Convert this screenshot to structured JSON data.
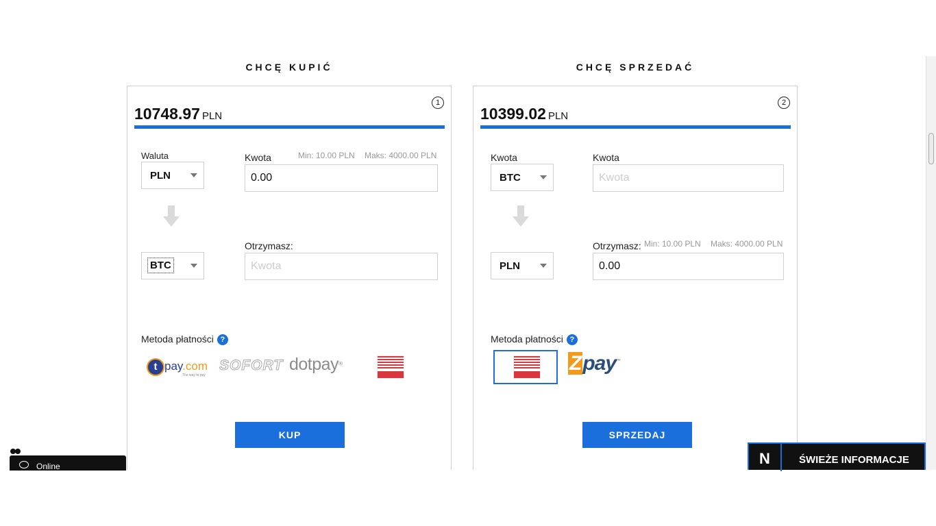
{
  "buy": {
    "heading": "CHCĘ KUPIĆ",
    "step": "1",
    "price": "10748.97",
    "price_currency": "PLN",
    "currency_label": "Waluta",
    "from_currency": "PLN",
    "amount_label": "Kwota",
    "min_hint": "Min: 10.00 PLN",
    "max_hint": "Maks: 4000.00 PLN",
    "amount_value": "0.00",
    "to_currency": "BTC",
    "receive_label": "Otrzymasz:",
    "receive_placeholder": "Kwota",
    "payment_label": "Metoda płatności",
    "payment_help": "?",
    "payment_methods": {
      "tpay_letter": "t",
      "tpay_name": "pay",
      "tpay_domain": ".com",
      "tpay_tagline": "The way to pay",
      "sofort": "SOFORT",
      "dotpay": "dotpay",
      "dotpay_mark": "®"
    },
    "button": "KUP"
  },
  "sell": {
    "heading": "CHCĘ SPRZEDAĆ",
    "step": "2",
    "price": "10399.02",
    "price_currency": "PLN",
    "amount_label_left": "Kwota",
    "from_currency": "BTC",
    "amount_label": "Kwota",
    "amount_placeholder": "Kwota",
    "receive_label": "Otrzymasz:",
    "min_hint": "Min: 10.00 PLN",
    "max_hint": "Maks: 4000.00 PLN",
    "to_currency": "PLN",
    "receive_value": "0.00",
    "payment_label": "Metoda płatności",
    "payment_help": "?",
    "payment_methods": {
      "zpay_z": "Z",
      "zpay_rest": "pay",
      "zpay_tm": "™"
    },
    "button": "SPRZEDAJ"
  },
  "chat": {
    "status": "Online"
  },
  "news": {
    "logo": "N",
    "title": "ŚWIEŻE INFORMACJE"
  },
  "colors": {
    "accent": "#1a6fdc",
    "orange": "#f39a1d",
    "red": "#d9363e"
  }
}
